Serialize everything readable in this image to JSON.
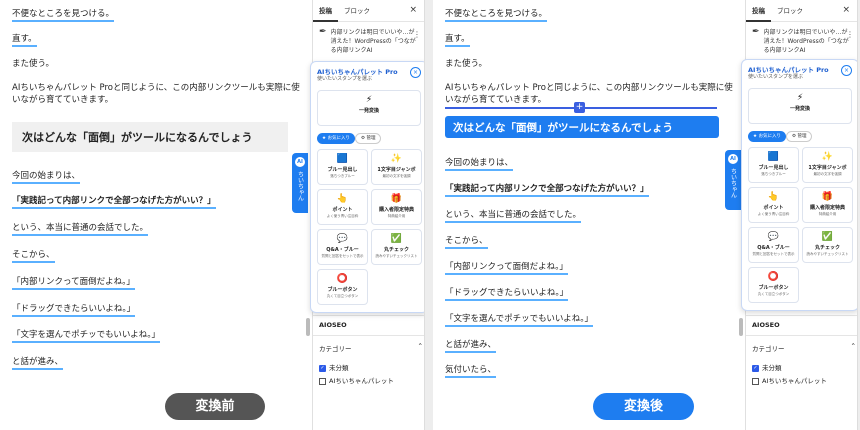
{
  "left": {
    "paragraphs": [
      {
        "text": "不便なところを見つける。",
        "underline": true,
        "bold": false
      },
      {
        "text": "直す。",
        "underline": true,
        "bold": false
      },
      {
        "text": "また使う。",
        "underline": false,
        "bold": false
      },
      {
        "text": "AIちいちゃんパレット Proと同じように、この内部リンクツールも実際に使いながら育てていきます。",
        "underline": false,
        "bold": false
      },
      {
        "text": "今回の始まりは、",
        "underline": true,
        "bold": false
      },
      {
        "text": "「実践記って内部リンクで全部つなげた方がいい？」",
        "underline": true,
        "bold": true
      },
      {
        "text": "という、本当に普通の会話でした。",
        "underline": true,
        "bold": false
      },
      {
        "text": "そこから、",
        "underline": true,
        "bold": false
      },
      {
        "text": "「内部リンクって面倒だよね。」",
        "underline": true,
        "bold": false
      },
      {
        "text": "「ドラッグできたらいいよね。」",
        "underline": true,
        "bold": false
      },
      {
        "text": "「文字を選んでポチッでもいいよね。」",
        "underline": true,
        "bold": false
      },
      {
        "text": "と話が進み、",
        "underline": true,
        "bold": false
      }
    ],
    "heading": "次はどんな「面倒」がツールになるんでしょう",
    "label": "変換前"
  },
  "right": {
    "paragraphs": [
      {
        "text": "不便なところを見つける。",
        "underline": true,
        "bold": false
      },
      {
        "text": "直す。",
        "underline": true,
        "bold": false
      },
      {
        "text": "また使う。",
        "underline": false,
        "bold": false
      },
      {
        "text": "AIちいちゃんパレット Proと同じように、この内部リンクツールも実際に使いながら育てていきます。",
        "underline": false,
        "bold": false
      },
      {
        "text": "今回の始まりは、",
        "underline": true,
        "bold": false
      },
      {
        "text": "「実践記って内部リンクで全部つなげた方がいい？」",
        "underline": true,
        "bold": true
      },
      {
        "text": "という、本当に普通の会話でした。",
        "underline": true,
        "bold": false
      },
      {
        "text": "そこから、",
        "underline": true,
        "bold": false
      },
      {
        "text": "「内部リンクって面倒だよね。」",
        "underline": true,
        "bold": false
      },
      {
        "text": "「ドラッグできたらいいよね。」",
        "underline": true,
        "bold": false
      },
      {
        "text": "「文字を選んでポチッでもいいよね。」",
        "underline": true,
        "bold": false
      },
      {
        "text": "と話が進み、",
        "underline": true,
        "bold": false
      },
      {
        "text": "気付いたら、",
        "underline": true,
        "bold": false
      }
    ],
    "heading": "次はどんな「面倒」がツールになるんでしょう",
    "label": "変換後"
  },
  "sidebar": {
    "tab_post": "投稿",
    "tab_block": "ブロック",
    "close": "×",
    "post_text": "内部リンクは明日でいいや…が消えた！WordPressの「つながる内部リンクAI",
    "aioseo": "AIOSEO",
    "category": "カテゴリー",
    "cat_1": "未分類",
    "cat_2": "AIちいちゃんパレット"
  },
  "ai_tab": {
    "circle": "AI",
    "text": "ちいちゃん"
  },
  "palette": {
    "title": "AIちいちゃんパレット Pro",
    "subtitle": "使いたいスタンプを選ぶ",
    "close": "×",
    "top_card": {
      "icon": "⚡",
      "title": "一発変換"
    },
    "pill_fav": "★ お気に入り",
    "pill_manage": "⚙ 管理",
    "cards": [
      {
        "icon": "🟦",
        "title": "ブルー見出し",
        "sub": "落ちつきブルー"
      },
      {
        "icon": "✨",
        "title": "1文字目ジャンボ",
        "sub": "最初の文字を強調"
      },
      {
        "icon": "👆",
        "title": "ポイント",
        "sub": "よく使う青い注目枠"
      },
      {
        "icon": "🎁",
        "title": "購入者限定特典",
        "sub": "特典紹介用"
      },
      {
        "icon": "💬",
        "title": "Q&A・ブルー",
        "sub": "質問と回答をセットで表示"
      },
      {
        "icon": "✅",
        "title": "丸チェック",
        "sub": "読みやすいチェックリスト"
      },
      {
        "icon": "⭕",
        "title": "ブルーボタン",
        "sub": "丸くて目立つボタン"
      }
    ]
  },
  "colors": {
    "accent": "#1e7df0",
    "underline": "#5ab0ff"
  }
}
